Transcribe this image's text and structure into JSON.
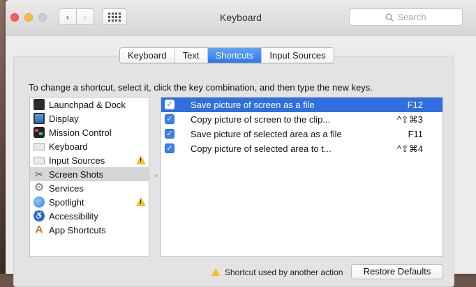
{
  "window": {
    "title": "Keyboard"
  },
  "toolbar": {
    "back_glyph": "‹",
    "forward_glyph": "›",
    "search_placeholder": "Search"
  },
  "tabs": [
    {
      "label": "Keyboard",
      "active": false
    },
    {
      "label": "Text",
      "active": false
    },
    {
      "label": "Shortcuts",
      "active": true
    },
    {
      "label": "Input Sources",
      "active": false
    }
  ],
  "instruction": "To change a shortcut, select it, click the key combination, and then type the new keys.",
  "categories": [
    {
      "label": "Launchpad & Dock",
      "icon": "launchpad-icon",
      "warning": false,
      "selected": false
    },
    {
      "label": "Display",
      "icon": "display-icon",
      "warning": false,
      "selected": false
    },
    {
      "label": "Mission Control",
      "icon": "mission-control-icon",
      "warning": false,
      "selected": false
    },
    {
      "label": "Keyboard",
      "icon": "keyboard-icon",
      "warning": false,
      "selected": false
    },
    {
      "label": "Input Sources",
      "icon": "input-sources-icon",
      "warning": true,
      "selected": false
    },
    {
      "label": "Screen Shots",
      "icon": "screenshot-icon",
      "warning": false,
      "selected": true
    },
    {
      "label": "Services",
      "icon": "gear-icon",
      "warning": false,
      "selected": false
    },
    {
      "label": "Spotlight",
      "icon": "spotlight-icon",
      "warning": true,
      "selected": false
    },
    {
      "label": "Accessibility",
      "icon": "accessibility-icon",
      "warning": false,
      "selected": false
    },
    {
      "label": "App Shortcuts",
      "icon": "app-shortcuts-icon",
      "warning": false,
      "selected": false
    }
  ],
  "shortcuts": [
    {
      "label": "Save picture of screen as a file",
      "keys": "F12",
      "checked": true,
      "selected": true
    },
    {
      "label": "Copy picture of screen to the clip...",
      "keys": "^⇧⌘3",
      "checked": true,
      "selected": false
    },
    {
      "label": "Save picture of selected area as a file",
      "keys": "F11",
      "checked": true,
      "selected": false
    },
    {
      "label": "Copy picture of selected area to t...",
      "keys": "^⇧⌘4",
      "checked": true,
      "selected": false
    }
  ],
  "footer": {
    "warning_text": "Shortcut used by another action",
    "restore_label": "Restore Defaults"
  },
  "colors": {
    "accent": "#2f6fe0",
    "warning": "#f2c021"
  }
}
